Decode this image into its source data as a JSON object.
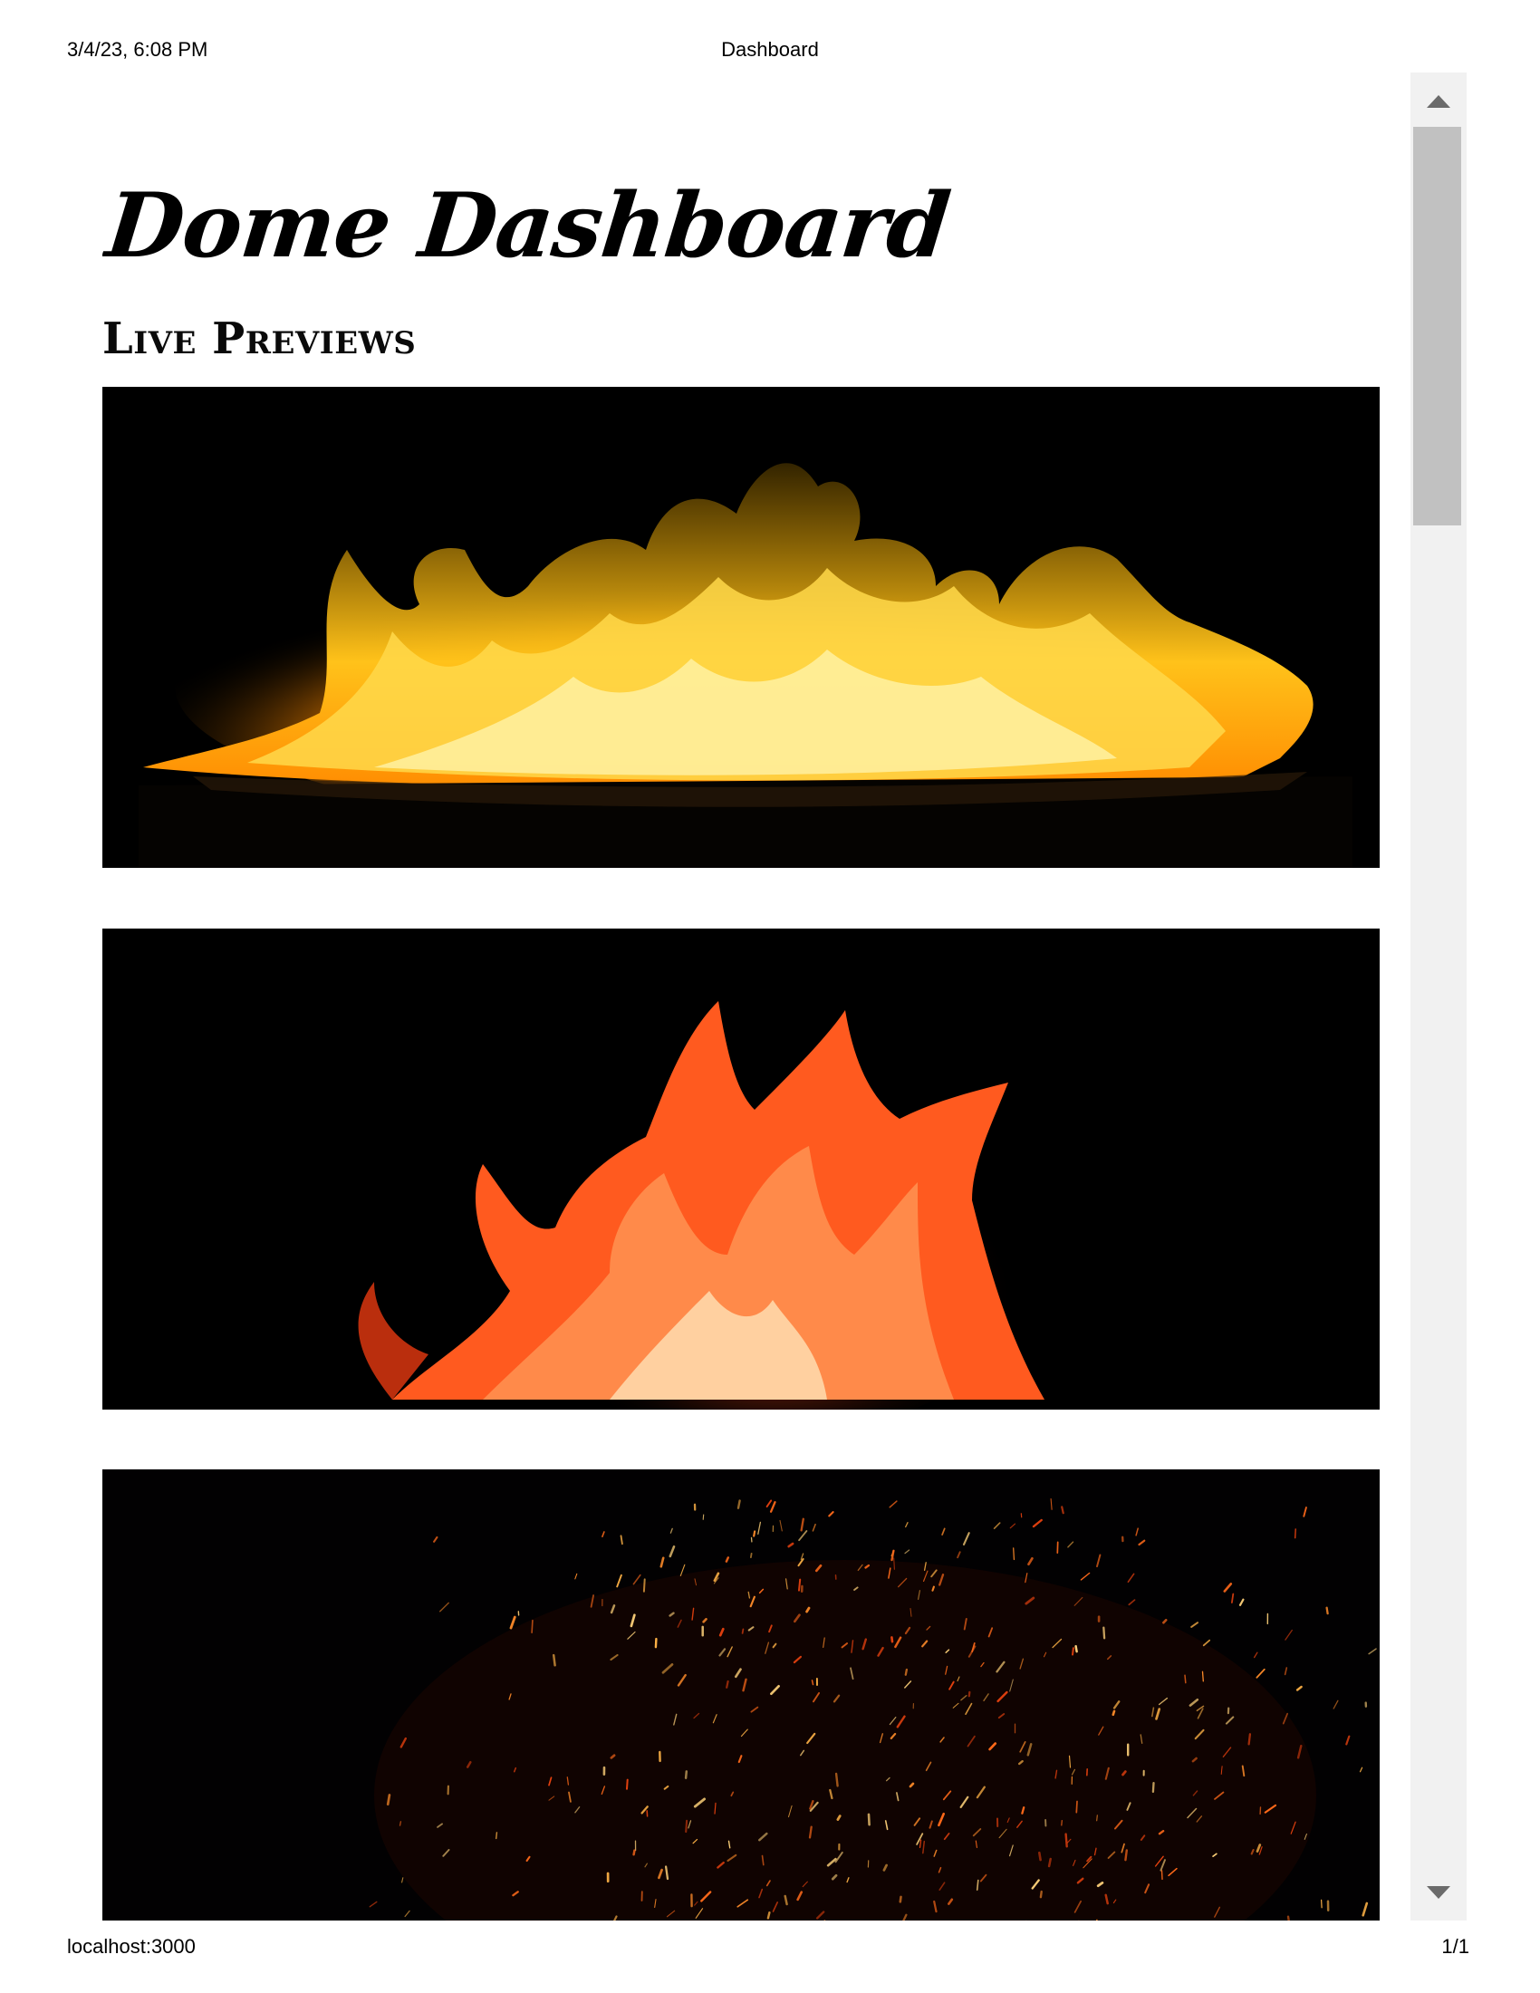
{
  "print_header": {
    "datetime": "3/4/23, 6:08 PM",
    "title": "Dashboard"
  },
  "print_footer": {
    "url": "localhost:3000",
    "page": "1/1"
  },
  "app": {
    "title": "Dome Dashboard"
  },
  "section": {
    "title": "Live Previews"
  },
  "previews": [
    {
      "name": "flames-golden",
      "description": "wide golden flames"
    },
    {
      "name": "flames-red",
      "description": "red-orange flames"
    },
    {
      "name": "sparks",
      "description": "flying sparks"
    }
  ],
  "colors": {
    "background": "#ffffff",
    "preview_background": "#000000",
    "scrollbar_track": "#f1f1f1",
    "scrollbar_thumb": "#c1c1c1",
    "scrollbar_arrow": "#6b6b6b"
  },
  "scrollbar": {
    "position_fraction": 0.0
  }
}
